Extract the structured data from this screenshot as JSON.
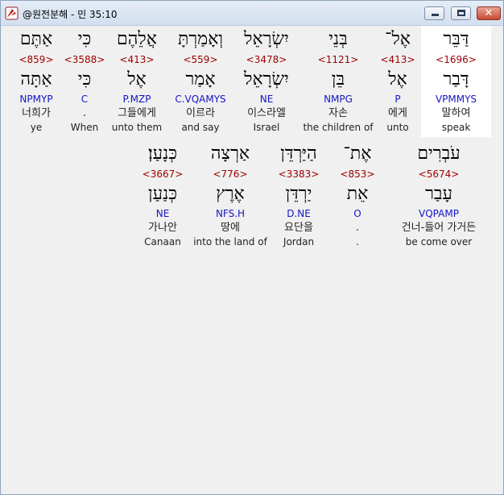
{
  "window": {
    "title": "@원전분해 - 민 35:10",
    "close_label": "✕"
  },
  "rows": [
    {
      "words": [
        {
          "hebrew": "אַתֶּם",
          "strongs": "<859>",
          "lemma": "אַתָּה",
          "parse": "NPMYP",
          "korean": "너희가",
          "english": "ye"
        },
        {
          "hebrew": "כִּי",
          "strongs": "<3588>",
          "lemma": "כִּי",
          "parse": "C",
          "korean": ".",
          "english": "When"
        },
        {
          "hebrew": "אֲלֵהֶם",
          "strongs": "<413>",
          "lemma": "אֶל",
          "parse": "P.MZP",
          "korean": "그들에게",
          "english": "unto them"
        },
        {
          "hebrew": "וְאָמַרְתָּ",
          "strongs": "<559>",
          "lemma": "אָמַר",
          "parse": "C.VQAMYS",
          "korean": "이르라",
          "english": "and say"
        },
        {
          "hebrew": "יִשְׂרָאֵל",
          "strongs": "<3478>",
          "lemma": "יִשְׂרָאֵל",
          "parse": "NE",
          "korean": "이스라엘",
          "english": "Israel"
        },
        {
          "hebrew": "בְּנֵי",
          "strongs": "<1121>",
          "lemma": "בֵּן",
          "parse": "NMPG",
          "korean": "자손",
          "english": "the children of"
        },
        {
          "hebrew": "אֶל־",
          "strongs": "<413>",
          "lemma": "אֶל",
          "parse": "P",
          "korean": "에게",
          "english": "unto"
        },
        {
          "hebrew": "דַּבֵּר",
          "strongs": "<1696>",
          "lemma": "דָּבַר",
          "parse": "VPMMYS",
          "korean": "말하여",
          "english": "speak"
        }
      ]
    },
    {
      "words": [
        {
          "hebrew": "כְּנָעַן׃",
          "strongs": "<3667>",
          "lemma": "כְּנַעַן",
          "parse": "NE",
          "korean": "가나안",
          "english": "Canaan"
        },
        {
          "hebrew": "אַרְצָה",
          "strongs": "<776>",
          "lemma": "אֶרֶץ",
          "parse": "NFS.H",
          "korean": "땅에",
          "english": "into the land of"
        },
        {
          "hebrew": "הַיַּרְדֵּן",
          "strongs": "<3383>",
          "lemma": "יַרְדֵּן",
          "parse": "D.NE",
          "korean": "요단을",
          "english": "Jordan"
        },
        {
          "hebrew": "אֶת־",
          "strongs": "<853>",
          "lemma": "אֵת",
          "parse": "O",
          "korean": ".",
          "english": "."
        },
        {
          "hebrew": "עֹבְרִים",
          "strongs": "<5674>",
          "lemma": "עָבַר",
          "parse": "VQPAMP",
          "korean": "건너-들어 가거든",
          "english": "be come over"
        }
      ]
    }
  ],
  "colors": {
    "strongs": "#a00000",
    "parse": "#1515c8",
    "highlight": "#ffffff"
  }
}
